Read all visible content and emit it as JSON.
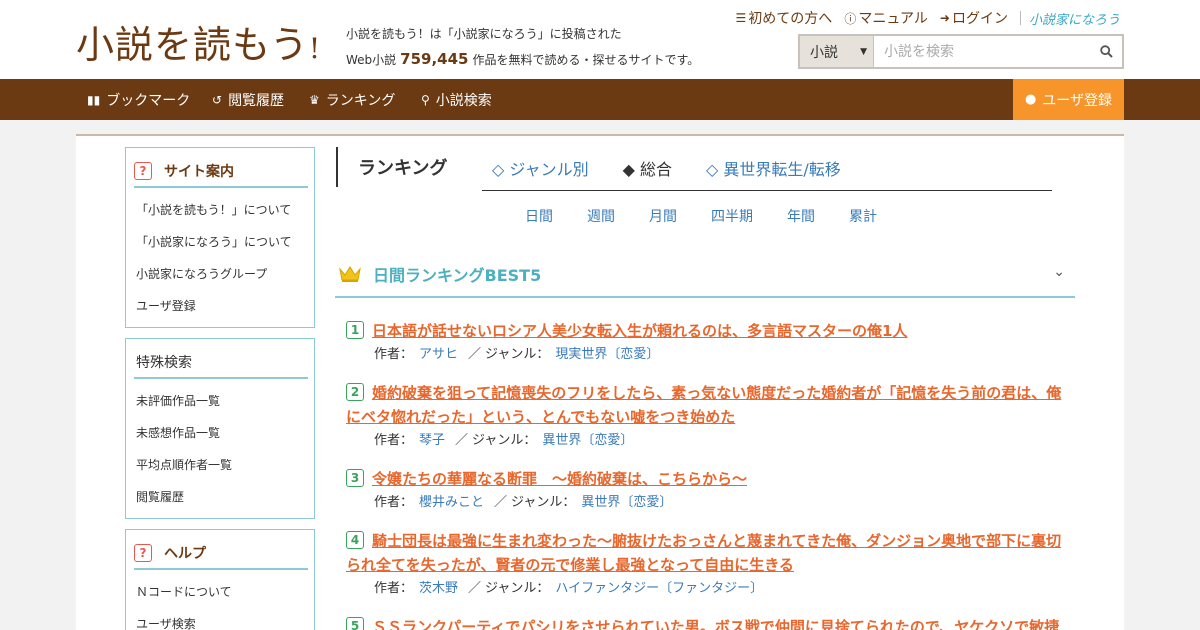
{
  "header": {
    "logo_main": "小説を読もう",
    "logo_mark": "!",
    "tagline_line1": "小説を読もう！は「小説家になろう」に投稿された",
    "tagline_pre": "Web小説",
    "work_count": "759,445",
    "tagline_post": "作品を無料で読める・探せるサイトです。",
    "links": [
      {
        "label": "初めての方へ",
        "icon": "book-icon"
      },
      {
        "label": "マニュアル",
        "icon": "question-icon"
      },
      {
        "label": "ログイン",
        "icon": "login-icon"
      }
    ],
    "narou_logo": "小説家になろう",
    "search": {
      "select_value": "小説",
      "placeholder": "小説を検索"
    }
  },
  "nav": {
    "items": [
      {
        "label": "ブックマーク",
        "icon": "bookmark-icon"
      },
      {
        "label": "閲覧履歴",
        "icon": "history-icon"
      },
      {
        "label": "ランキング",
        "icon": "crown-icon"
      },
      {
        "label": "小説検索",
        "icon": "search-icon"
      }
    ],
    "register": "ユーザ登録"
  },
  "sidebar": {
    "site_guide": {
      "title": "サイト案内",
      "items": [
        "「小説を読もう！」について",
        "「小説家になろう」について",
        "小説家になろうグループ",
        "ユーザ登録"
      ]
    },
    "special_search": {
      "title": "特殊検索",
      "items": [
        "未評価作品一覧",
        "未感想作品一覧",
        "平均点順作者一覧",
        "閲覧履歴"
      ]
    },
    "help": {
      "title": "ヘルプ",
      "items": [
        "Ｎコードについて",
        "ユーザ検索"
      ]
    }
  },
  "ranking": {
    "title": "ランキング",
    "tabs": [
      {
        "label": "◇ ジャンル別",
        "active": false
      },
      {
        "label": "◆ 総合",
        "active": true
      },
      {
        "label": "◇ 異世界転生/転移",
        "active": false
      }
    ],
    "periods": [
      "日間",
      "週間",
      "月間",
      "四半期",
      "年間",
      "累計"
    ],
    "best_title": "日間ランキングBEST5",
    "author_label": "作者：",
    "genre_label": "ジャンル：",
    "entries": [
      {
        "rank": "1",
        "title": "日本語が話せないロシア人美少女転入生が頼れるのは、多言語マスターの俺1人",
        "author": "アサヒ",
        "genre": "現実世界〔恋愛〕"
      },
      {
        "rank": "2",
        "title": "婚約破棄を狙って記憶喪失のフリをしたら、素っ気ない態度だった婚約者が「記憶を失う前の君は、俺にベタ惚れだった」という、とんでもない嘘をつき始めた",
        "author": "琴子",
        "genre": "異世界〔恋愛〕"
      },
      {
        "rank": "3",
        "title": "令嬢たちの華麗なる断罪　～婚約破棄は、こちらから～",
        "author": "櫻井みこと",
        "genre": "異世界〔恋愛〕"
      },
      {
        "rank": "4",
        "title": "騎士団長は最強に生まれ変わった～腑抜けたおっさんと蔑まれてきた俺、ダンジョン奥地で部下に裏切られ全てを失ったが、賢者の元で修業し最強となって自由に生きる",
        "author": "茨木野",
        "genre": "ハイファンタジー〔ファンタジー〕"
      },
      {
        "rank": "5",
        "title": "ＳＳランクパーティでパシリをさせられていた男。ボス戦で仲間に見捨てられたので、ヤケクソで敏捷",
        "author": "",
        "genre": ""
      }
    ]
  }
}
